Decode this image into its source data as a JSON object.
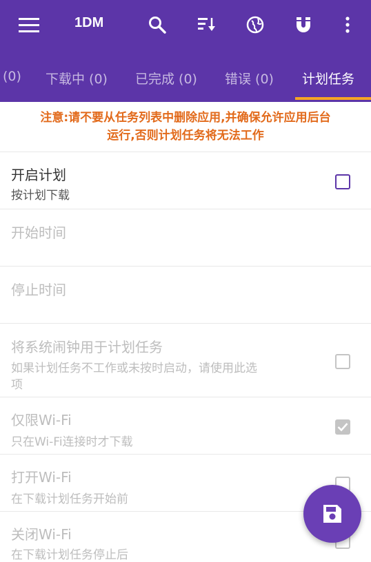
{
  "toolbar": {
    "title": "1DM",
    "icons": [
      "menu-icon",
      "search-icon",
      "sort-icon",
      "globe-icon",
      "magnet-icon",
      "more-vert-icon"
    ]
  },
  "tabs": [
    {
      "label": "(0)"
    },
    {
      "label": "下载中 (0)"
    },
    {
      "label": "已完成 (0)"
    },
    {
      "label": "错误 (0)"
    },
    {
      "label": "计划任务",
      "active": true
    }
  ],
  "notice": {
    "line1": "注意:请不要从任务列表中删除应用,并确保允许应用后台",
    "line2": "运行,否则计划任务将无法工作"
  },
  "settings": {
    "enable": {
      "title": "开启计划",
      "subtitle": "按计划下载",
      "checked": false
    },
    "start_time": {
      "title": "开始时间"
    },
    "stop_time": {
      "title": "停止时间"
    },
    "alarm": {
      "title": "将系统闹钟用于计划任务",
      "subtitle_line1": "如果计划任务不工作或未按时启动，请使用此选",
      "subtitle_line2": "项",
      "checked": false
    },
    "wifi_only": {
      "title": "仅限Wi-Fi",
      "subtitle": "只在Wi-Fi连接时才下载",
      "checked": true
    },
    "wifi_on": {
      "title": "打开Wi-Fi",
      "subtitle": "在下载计划任务开始前",
      "checked": false
    },
    "wifi_off": {
      "title": "关闭Wi-Fi",
      "subtitle": "在下载计划任务停止后",
      "checked": false
    }
  },
  "fab": {
    "icon": "save-icon"
  },
  "colors": {
    "primary": "#5c35a8",
    "accent": "#f5a623",
    "notice": "#e26a1b",
    "fab": "#6a3fb5"
  }
}
